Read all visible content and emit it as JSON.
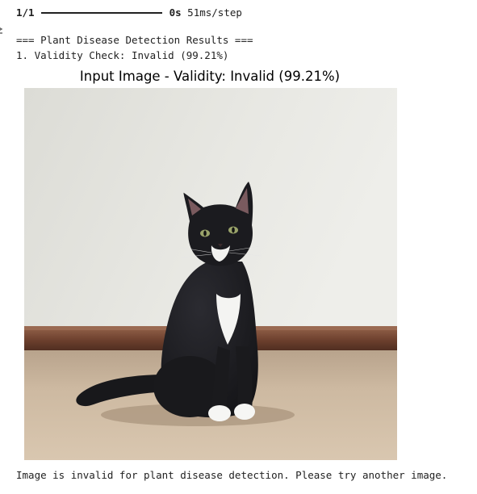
{
  "progress": {
    "steps": "1/1",
    "time": "0s",
    "rate": " 51ms/step",
    "fraction_complete": 1.0
  },
  "output": {
    "header": "=== Plant Disease Detection Results ===",
    "validity_check": "1. Validity Check: Invalid (99.21%)",
    "figure_title": "Input Image - Validity: Invalid (99.21%)",
    "result_message": "Image is invalid for plant disease detection. Please try another image."
  },
  "icons": {
    "gutter": "output-cell-icon"
  },
  "colors": {
    "text": "#212121",
    "wall": "#e4e4df",
    "baseboard": "#6e4331",
    "carpet": "#cbb79f",
    "cat": "#1c1c1f"
  }
}
